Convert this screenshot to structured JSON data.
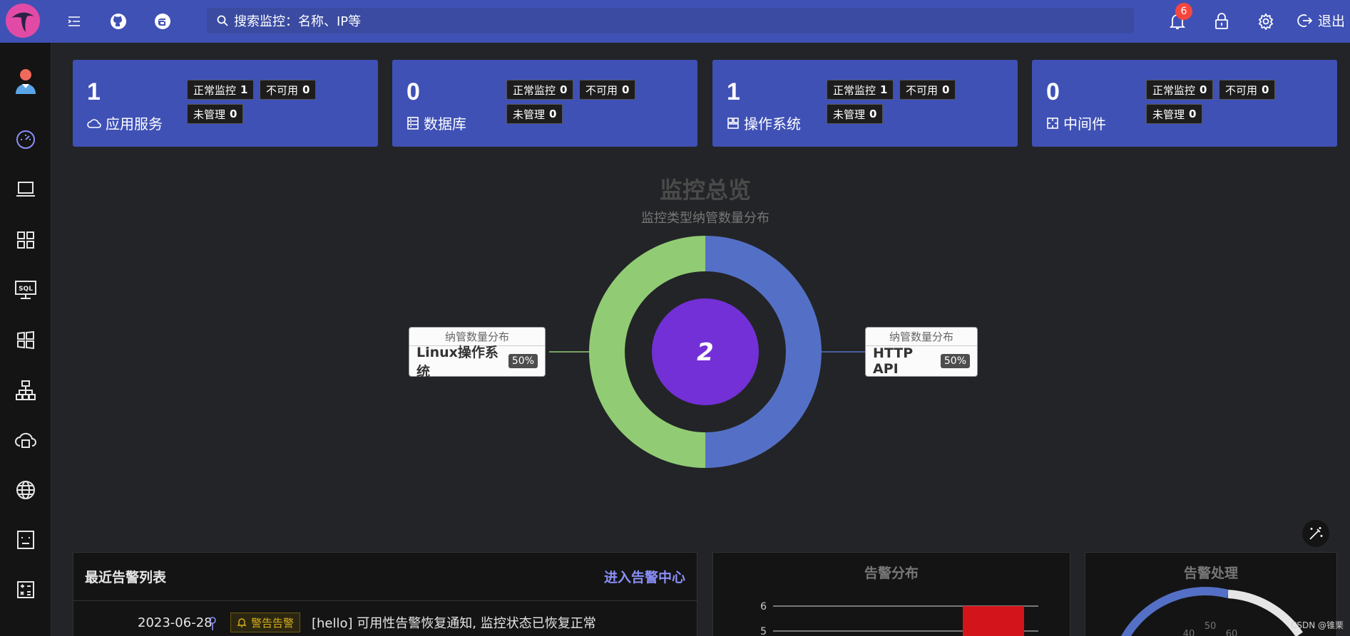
{
  "header": {
    "search_placeholder": "搜索监控：名称、IP等",
    "notification_count": "6",
    "logout_label": "退出"
  },
  "cards": [
    {
      "count": "1",
      "label": "应用服务",
      "icon": "cloud-icon",
      "normal_label": "正常监控",
      "normal": "1",
      "unavailable_label": "不可用",
      "unavailable": "0",
      "unmanaged_label": "未管理",
      "unmanaged": "0"
    },
    {
      "count": "0",
      "label": "数据库",
      "icon": "database-icon",
      "normal_label": "正常监控",
      "normal": "0",
      "unavailable_label": "不可用",
      "unavailable": "0",
      "unmanaged_label": "未管理",
      "unmanaged": "0"
    },
    {
      "count": "1",
      "label": "操作系统",
      "icon": "os-icon",
      "normal_label": "正常监控",
      "normal": "1",
      "unavailable_label": "不可用",
      "unavailable": "0",
      "unmanaged_label": "未管理",
      "unmanaged": "0"
    },
    {
      "count": "0",
      "label": "中间件",
      "icon": "middleware-icon",
      "normal_label": "正常监控",
      "normal": "0",
      "unavailable_label": "不可用",
      "unavailable": "0",
      "unmanaged_label": "未管理",
      "unmanaged": "0"
    }
  ],
  "overview": {
    "title": "监控总览",
    "subtitle": "监控类型纳管数量分布",
    "total": "2",
    "tooltip_head": "纳管数量分布"
  },
  "chart_data": {
    "type": "pie",
    "title": "监控总览",
    "subtitle": "监控类型纳管数量分布",
    "center_value": 2,
    "series": [
      {
        "name": "HTTP API",
        "value": 1,
        "percent": "50%",
        "color": "#5470c6"
      },
      {
        "name": "Linux操作系统",
        "value": 1,
        "percent": "50%",
        "color": "#91cc75"
      }
    ]
  },
  "alerts_panel": {
    "title": "最近告警列表",
    "link": "进入告警中心",
    "rows": [
      {
        "time": "2023-06-28",
        "tag": "警告告警",
        "message": "[hello] 可用性告警恢复通知, 监控状态已恢复正常"
      }
    ]
  },
  "distribution_panel": {
    "title": "告警分布",
    "ticks": [
      "6",
      "5"
    ],
    "bar_color": "#d3141b"
  },
  "handling_panel": {
    "title": "告警处理",
    "gauge_ticks": [
      "40",
      "50",
      "60"
    ]
  },
  "watermark": "CSDN @锥栗",
  "sidebar_icons": [
    "user-avatar",
    "dashboard-icon",
    "laptop-icon",
    "apps-icon",
    "sql-icon",
    "windows-icon",
    "cluster-icon",
    "cloud-server-icon",
    "globe-icon",
    "robot-icon",
    "calculator-icon"
  ]
}
